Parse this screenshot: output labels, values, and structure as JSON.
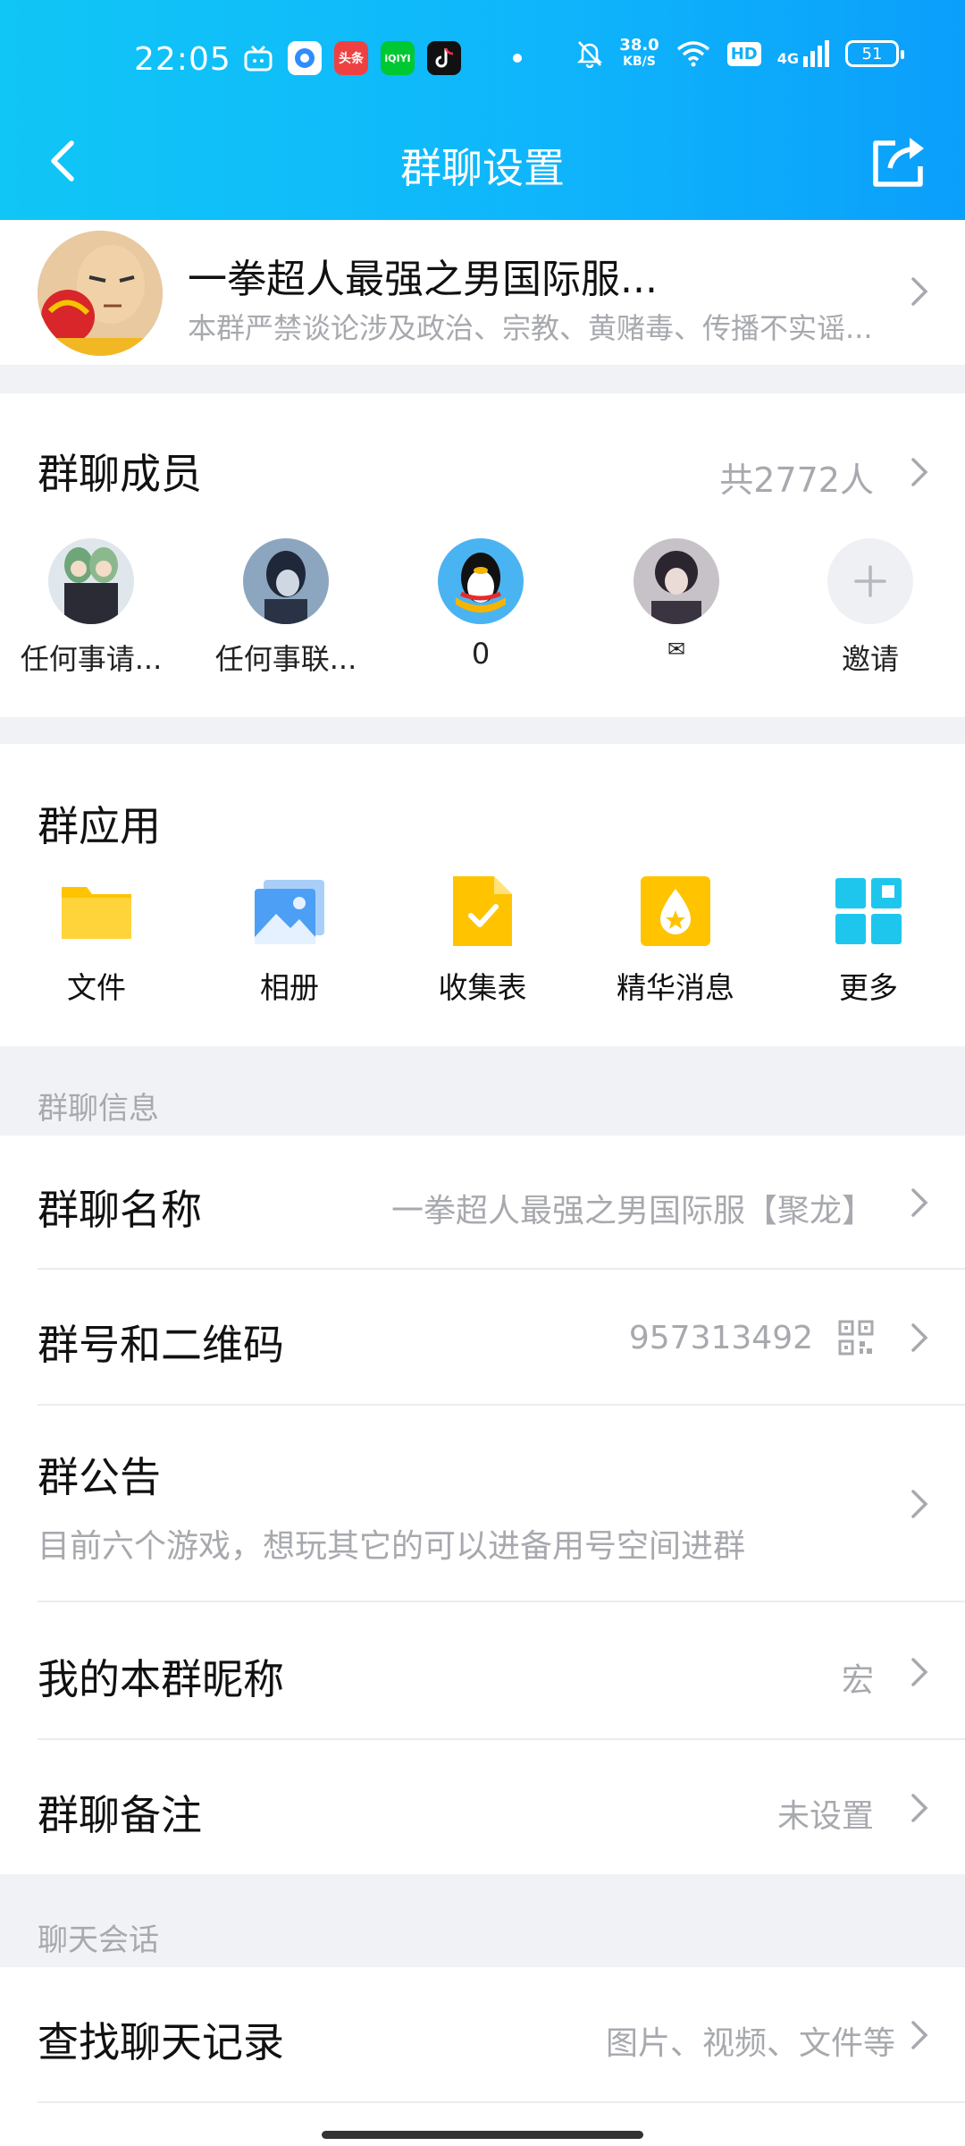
{
  "status_bar": {
    "time": "22:05",
    "net_speed": "38.0",
    "net_unit": "KB/S",
    "hd_badge": "HD",
    "signal": "4G",
    "battery": "51",
    "app_badges": [
      "头条",
      "iQIYI"
    ]
  },
  "nav": {
    "title": "群聊设置"
  },
  "group": {
    "name": "一拳超人最强之男国际服...",
    "desc": "本群严禁谈论涉及政治、宗教、黄赌毒、传播不实谣..."
  },
  "members": {
    "title": "群聊成员",
    "count": "共2772人",
    "list": [
      {
        "name": "任何事请..."
      },
      {
        "name": "任何事联..."
      },
      {
        "name": "0"
      },
      {
        "name": "✉"
      },
      {
        "name": "邀请"
      }
    ]
  },
  "apps": {
    "title": "群应用",
    "list": [
      {
        "label": "文件",
        "icon": "folder-icon"
      },
      {
        "label": "相册",
        "icon": "photo-album-icon"
      },
      {
        "label": "收集表",
        "icon": "form-icon"
      },
      {
        "label": "精华消息",
        "icon": "essence-icon"
      },
      {
        "label": "更多",
        "icon": "more-grid-icon"
      }
    ]
  },
  "info": {
    "caption": "群聊信息",
    "name_label": "群聊名称",
    "name_value": "一拳超人最强之男国际服【聚龙】",
    "number_label": "群号和二维码",
    "number_value": "957313492",
    "notice_label": "群公告",
    "notice_value": "目前六个游戏，想玩其它的可以进备用号空间进群",
    "nickname_label": "我的本群昵称",
    "nickname_value": "宏",
    "remark_label": "群聊备注",
    "remark_value": "未设置"
  },
  "chat": {
    "caption": "聊天会话",
    "search_label": "查找聊天记录",
    "search_value": "图片、视频、文件等"
  },
  "colors": {
    "header_start": "#10c6f6",
    "header_end": "#0b9ffb",
    "secondary_text": "#a7a9ae",
    "background": "#f1f2f5"
  }
}
